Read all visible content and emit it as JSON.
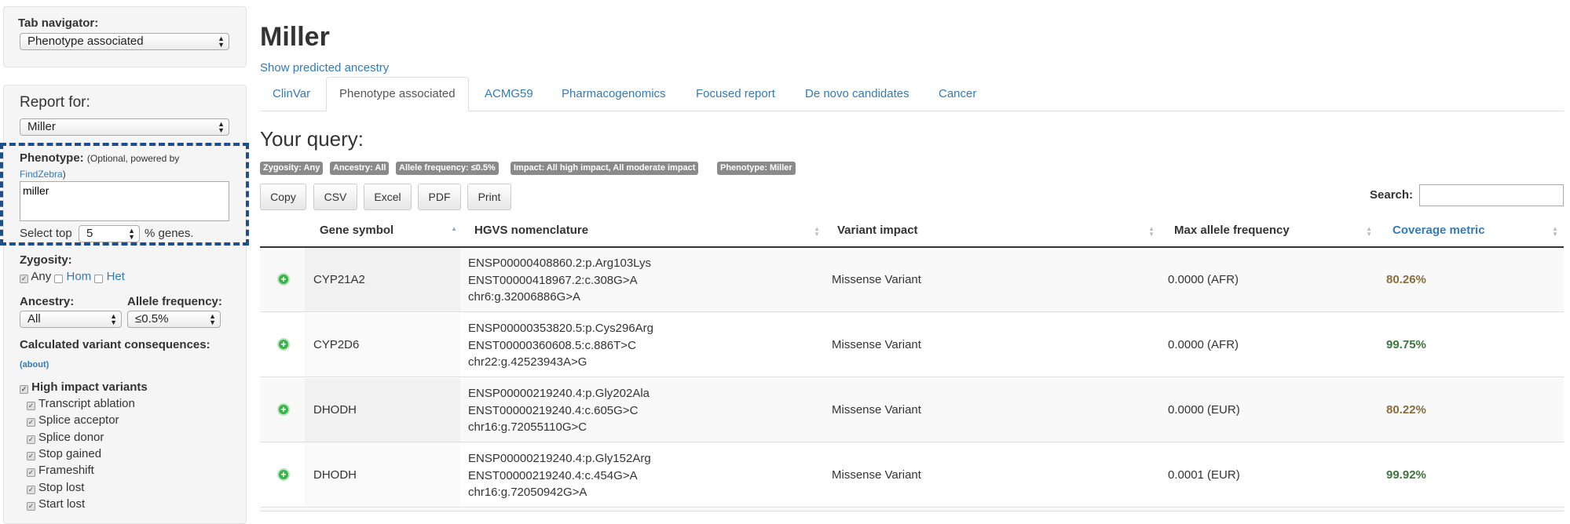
{
  "sidebar": {
    "tab_navigator_label": "Tab navigator:",
    "tab_navigator_value": "Phenotype associated",
    "report_for_label": "Report for:",
    "report_for_value": "Miller",
    "phenotype_label": "Phenotype:",
    "phenotype_note_prefix": "(Optional, powered by",
    "phenotype_note_link": "FindZebra",
    "phenotype_note_suffix": ")",
    "phenotype_value": "miller",
    "select_top_label": "Select top",
    "select_top_value": "5",
    "select_top_suffix": "% genes.",
    "zygosity_label": "Zygosity:",
    "zygosity_any": "Any",
    "zygosity_hom": "Hom",
    "zygosity_het": "Het",
    "ancestry_label": "Ancestry:",
    "ancestry_value": "All",
    "allele_freq_label": "Allele frequency:",
    "allele_freq_value": "≤0.5%",
    "consequences_label": "Calculated variant consequences:",
    "about_link": "(about)",
    "high_impact_label": "High impact variants",
    "high_impact_items": [
      "Transcript ablation",
      "Splice acceptor",
      "Splice donor",
      "Stop gained",
      "Frameshift",
      "Stop lost",
      "Start lost"
    ]
  },
  "main": {
    "title": "Miller",
    "ancestry_link": "Show predicted ancestry",
    "tabs": [
      {
        "label": "ClinVar"
      },
      {
        "label": "Phenotype associated"
      },
      {
        "label": "ACMG59"
      },
      {
        "label": "Pharmacogenomics"
      },
      {
        "label": "Focused report"
      },
      {
        "label": "De novo candidates"
      },
      {
        "label": "Cancer"
      }
    ],
    "active_tab": "Phenotype associated",
    "query_title": "Your query:",
    "badges": [
      "Zygosity: Any",
      "Ancestry: All",
      "Allele frequency: ≤0.5%",
      "Impact: All high impact, All moderate impact",
      "Phenotype: Miller"
    ],
    "buttons": [
      "Copy",
      "CSV",
      "Excel",
      "PDF",
      "Print"
    ],
    "search_label": "Search:",
    "search_value": ""
  },
  "table": {
    "headers": [
      "Gene symbol",
      "HGVS nomenclature",
      "Variant impact",
      "Max allele frequency",
      "Coverage metric"
    ],
    "rows": [
      {
        "gene": "CYP21A2",
        "hgvs": [
          "ENSP00000408860.2:p.Arg103Lys",
          "ENST00000418967.2:c.308G>A",
          "chr6:g.32006886G>A"
        ],
        "impact": "Missense Variant",
        "maf": "0.0000 (AFR)",
        "coverage": "80.26%",
        "coverage_color": "#8a6d3b"
      },
      {
        "gene": "CYP2D6",
        "hgvs": [
          "ENSP00000353820.5:p.Cys296Arg",
          "ENST00000360608.5:c.886T>C",
          "chr22:g.42523943A>G"
        ],
        "impact": "Missense Variant",
        "maf": "0.0000 (AFR)",
        "coverage": "99.75%",
        "coverage_color": "#3c763d"
      },
      {
        "gene": "DHODH",
        "hgvs": [
          "ENSP00000219240.4:p.Gly202Ala",
          "ENST00000219240.4:c.605G>C",
          "chr16:g.72055110G>C"
        ],
        "impact": "Missense Variant",
        "maf": "0.0000 (EUR)",
        "coverage": "80.22%",
        "coverage_color": "#8a6d3b"
      },
      {
        "gene": "DHODH",
        "hgvs": [
          "ENSP00000219240.4:p.Gly152Arg",
          "ENST00000219240.4:c.454G>A",
          "chr16:g.72050942G>A"
        ],
        "impact": "Missense Variant",
        "maf": "0.0001 (EUR)",
        "coverage": "99.92%",
        "coverage_color": "#3c763d"
      }
    ]
  },
  "colors": {
    "link": "#337ab7",
    "highlight_border": "#1f4e8c",
    "expand_icon": "#3cb34a"
  }
}
